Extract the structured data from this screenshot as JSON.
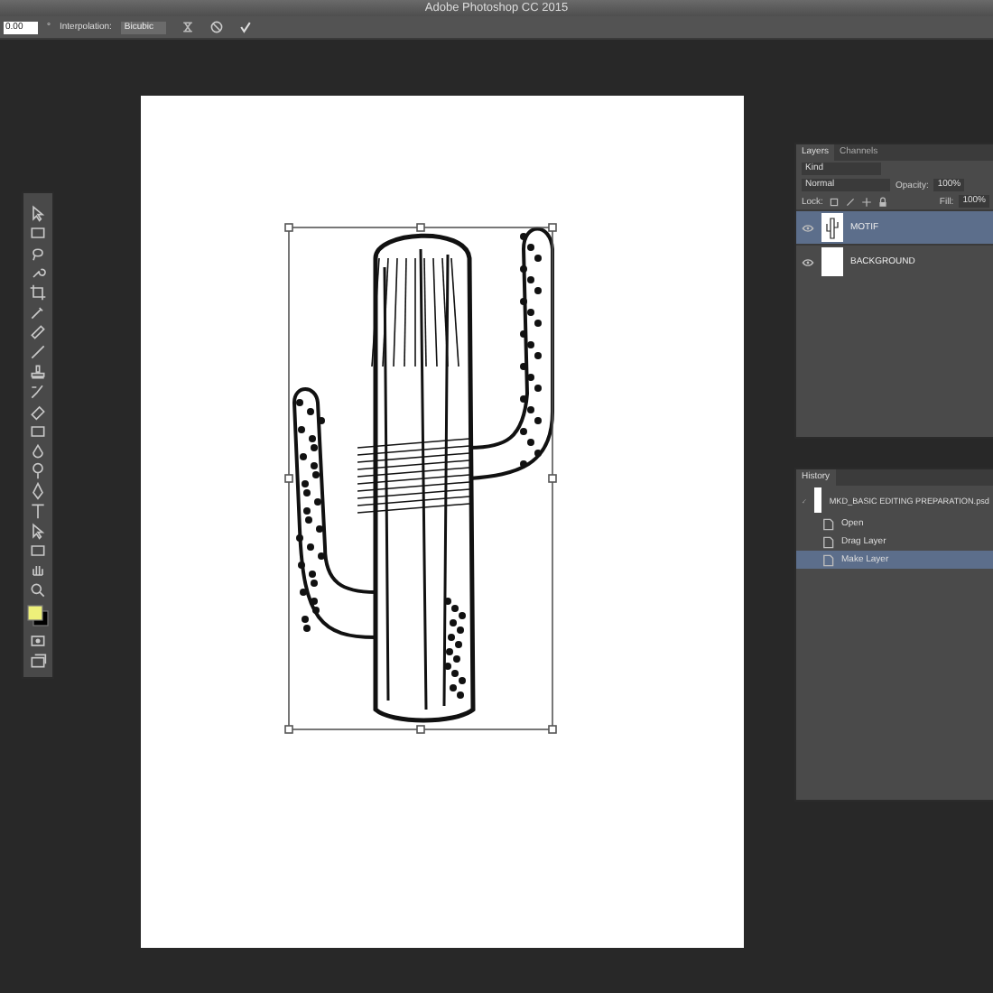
{
  "window": {
    "title": "Adobe Photoshop CC 2015"
  },
  "options_bar": {
    "angle": "0.00",
    "degree_sign": "°",
    "interpolation_label": "Interpolation:",
    "interpolation": "Bicubic"
  },
  "layers_panel": {
    "tabs": [
      {
        "label": "Layers",
        "selected": true
      },
      {
        "label": "Channels",
        "selected": false
      }
    ],
    "filter": "Kind",
    "blend_mode": "Normal",
    "opacity_label": "Opacity:",
    "opacity": "100%",
    "lock_label": "Lock:",
    "fill_label": "Fill:",
    "fill": "100%",
    "layers": [
      {
        "name": "MOTIF",
        "selected": true,
        "visible": true
      },
      {
        "name": "BACKGROUND",
        "selected": false,
        "visible": true
      }
    ]
  },
  "history_panel": {
    "title": "History",
    "snapshot": "MKD_BASIC EDITING PREPARATION.psd",
    "steps": [
      {
        "label": "Open",
        "selected": false
      },
      {
        "label": "Drag Layer",
        "selected": false
      },
      {
        "label": "Make Layer",
        "selected": true
      }
    ]
  }
}
